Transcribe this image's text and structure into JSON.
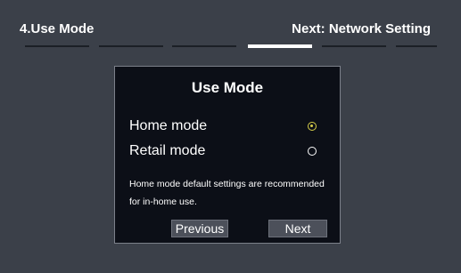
{
  "header": {
    "step_label": "4.Use Mode",
    "next_label": "Next: Network Setting"
  },
  "progress": {
    "total_steps": 6,
    "current_step": 4
  },
  "dialog": {
    "title": "Use Mode",
    "options": [
      {
        "label": "Home mode",
        "selected": true
      },
      {
        "label": "Retail mode",
        "selected": false
      }
    ],
    "description_line1": "Home mode default settings are recommended",
    "description_line2": "for in-home use.",
    "previous_label": "Previous",
    "next_label": "Next"
  },
  "colors": {
    "background": "#3b4049",
    "dialog_background": "#0c0f17",
    "selected_radio": "#d8cf4a",
    "button": "#4c505a"
  }
}
